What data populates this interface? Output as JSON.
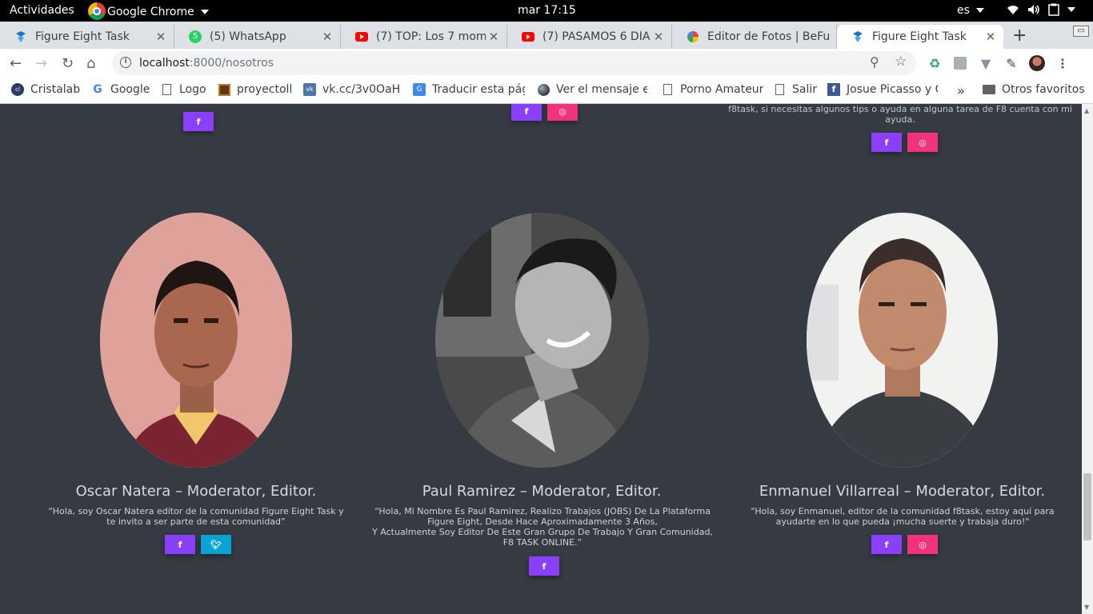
{
  "system_bar": {
    "activities": "Actividades",
    "app_name": "Google Chrome",
    "clock": "mar 17:15",
    "language": "es"
  },
  "tabs": [
    {
      "title": "Figure Eight Task",
      "icon": "figure-eight-favicon",
      "active": false
    },
    {
      "title": "(5) WhatsApp",
      "icon": "whatsapp-favicon",
      "badge": "5",
      "active": false
    },
    {
      "title": "(7) TOP: Los 7 mome",
      "icon": "youtube-favicon",
      "active": false
    },
    {
      "title": "(7) PASAMOS 6 DÍAS",
      "icon": "youtube-favicon",
      "active": false
    },
    {
      "title": "Editor de Fotos | BeFu",
      "icon": "befunky-favicon",
      "active": false
    },
    {
      "title": "Figure Eight Task",
      "icon": "figure-eight-favicon",
      "active": true
    }
  ],
  "toolbar": {
    "url_host": "localhost",
    "url_path": ":8000/nosotros"
  },
  "bookmarks": [
    {
      "label": "Cristalab",
      "icon": "cristalab-icon"
    },
    {
      "label": "Google",
      "icon": "google-icon"
    },
    {
      "label": "Logo",
      "icon": "page-icon"
    },
    {
      "label": "proyectoll",
      "icon": "proyecto-icon"
    },
    {
      "label": "vk.cc/3v0OaH",
      "icon": "vk-icon"
    },
    {
      "label": "Traducir esta pág",
      "icon": "translate-icon"
    },
    {
      "label": "Ver el mensaje er",
      "icon": "globe-icon"
    },
    {
      "label": "Porno Amateur",
      "icon": "page-icon"
    },
    {
      "label": "Salir",
      "icon": "page-icon"
    },
    {
      "label": "Josue Picasso y C",
      "icon": "facebook-icon"
    }
  ],
  "bookmarks_more": "»",
  "other_bookmarks": "Otros favoritos",
  "page": {
    "top_note": "f8task, si necesitas algunos tips o ayuda en alguna tarea de F8 cuenta con mi ayuda.",
    "members": [
      {
        "name": "Oscar Natera – Moderator, Editor.",
        "quote": "“Hola, soy Oscar Natera editor de la comunidad Figure Eight Task y te invito a ser parte de esta comunidad”"
      },
      {
        "name": "Paul Ramirez – Moderator, Editor.",
        "quote_lines": [
          "“Hola, Mi Nombre Es Paul Ramirez, Realizo Trabajos (JOBS) De La Plataforma Figure Eight, Desde Hace Aproximadamente 3 Años,",
          "Y Actualmente Soy Editor De Este Gran Grupo De Trabajo Y Gran Comunidad, F8 TASK ONLINE.”"
        ]
      },
      {
        "name": "Enmanuel Villarreal – Moderator, Editor.",
        "quote": "\"Hola, soy Enmanuel, editor de la comunidad f8task, estoy aquí para ayudarte en lo que pueda ¡mucha suerte y trabaja duro!\""
      }
    ]
  },
  "colors": {
    "page_bg": "#363a42",
    "facebook_button": "#8a3ffc",
    "instagram_button": "#f2327a",
    "twitter_button": "#0aa3d8"
  }
}
